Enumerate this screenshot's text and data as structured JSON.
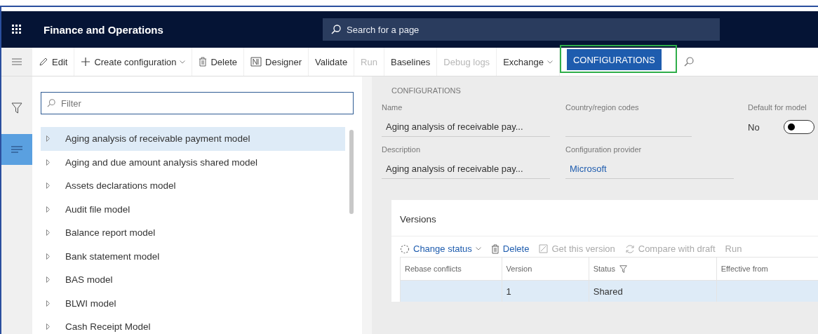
{
  "header": {
    "app_title": "Finance and Operations",
    "search_placeholder": "Search for a page"
  },
  "toolbar": [
    {
      "label": "Edit",
      "kind": "edit",
      "disabled": false,
      "selected": false,
      "highlighted": false
    },
    {
      "label": "Create configuration",
      "kind": "add-menu",
      "disabled": false,
      "selected": false,
      "highlighted": false
    },
    {
      "label": "Delete",
      "kind": "delete",
      "disabled": false,
      "selected": false,
      "highlighted": false
    },
    {
      "label": "Designer",
      "kind": "designer",
      "disabled": false,
      "selected": false,
      "highlighted": false
    },
    {
      "label": "Validate",
      "kind": "plain",
      "disabled": false,
      "selected": false,
      "highlighted": false
    },
    {
      "label": "Run",
      "kind": "plain",
      "disabled": true,
      "selected": false,
      "highlighted": false
    },
    {
      "label": "Baselines",
      "kind": "plain",
      "disabled": false,
      "selected": false,
      "highlighted": false
    },
    {
      "label": "Debug logs",
      "kind": "plain",
      "disabled": true,
      "selected": false,
      "highlighted": false
    },
    {
      "label": "Exchange",
      "kind": "menu",
      "disabled": false,
      "selected": false,
      "highlighted": false
    },
    {
      "label": "CONFIGURATIONS",
      "kind": "plain",
      "disabled": false,
      "selected": true,
      "highlighted": true
    }
  ],
  "filter": {
    "placeholder": "Filter"
  },
  "tree": [
    {
      "label": "Aging analysis of receivable payment model",
      "selected": true
    },
    {
      "label": "Aging and due amount analysis shared model",
      "selected": false
    },
    {
      "label": "Assets declarations model",
      "selected": false
    },
    {
      "label": "Audit file model",
      "selected": false
    },
    {
      "label": "Balance report model",
      "selected": false
    },
    {
      "label": "Bank statement model",
      "selected": false
    },
    {
      "label": "BAS model",
      "selected": false
    },
    {
      "label": "BLWI model",
      "selected": false
    },
    {
      "label": "Cash Receipt Model",
      "selected": false
    }
  ],
  "details": {
    "section_title": "CONFIGURATIONS",
    "name": {
      "label": "Name",
      "value": "Aging analysis of receivable pay..."
    },
    "country_region_codes": {
      "label": "Country/region codes"
    },
    "default_for_model": {
      "label": "Default for model",
      "value": "No",
      "on": false
    },
    "description": {
      "label": "Description",
      "value": "Aging analysis of receivable pay..."
    },
    "configuration_provider": {
      "label": "Configuration provider",
      "value": "Microsoft"
    }
  },
  "versions": {
    "title": "Versions",
    "actions": [
      {
        "label": "Change status",
        "kind": "status-menu",
        "disabled": false
      },
      {
        "label": "Delete",
        "kind": "delete",
        "disabled": false
      },
      {
        "label": "Get this version",
        "kind": "get",
        "disabled": true
      },
      {
        "label": "Compare with draft",
        "kind": "compare",
        "disabled": true
      },
      {
        "label": "Run",
        "kind": "plain",
        "disabled": true
      }
    ],
    "columns": [
      {
        "label": "Rebase conflicts",
        "filtered": false
      },
      {
        "label": "Version",
        "filtered": false
      },
      {
        "label": "Status",
        "filtered": true
      },
      {
        "label": "Effective from",
        "filtered": false
      }
    ],
    "rows": [
      {
        "cells": [
          "",
          "1",
          "Shared",
          ""
        ],
        "selected": true
      }
    ]
  }
}
